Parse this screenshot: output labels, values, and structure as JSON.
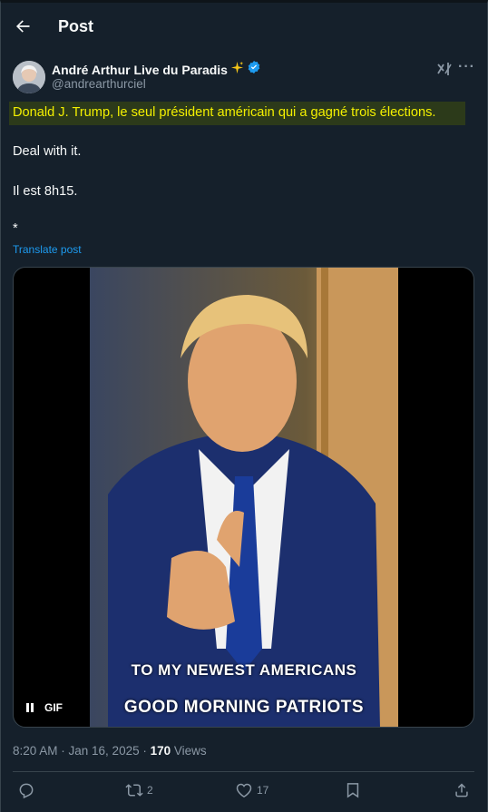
{
  "header": {
    "title": "Post"
  },
  "author": {
    "display_name": "André Arthur Live du Paradis",
    "handle": "@andrearthurciel",
    "verified": true
  },
  "post": {
    "highlighted_line": "Donald J. Trump, le seul président américain qui a gagné trois élections.",
    "line2": "Deal with it.",
    "line3": "Il est 8h15.",
    "line4": "*",
    "translate_label": "Translate post"
  },
  "media": {
    "caption_top": "TO MY NEWEST AMERICANS",
    "caption_bottom": "GOOD MORNING PATRIOTS",
    "gif_label": "GIF"
  },
  "meta": {
    "timestamp": "8:20 AM · Jan 16, 2025 · ",
    "views_count": "170",
    "views_label": " Views"
  },
  "actions": {
    "reposts": "2",
    "likes": "17"
  },
  "colors": {
    "background": "#15202b",
    "highlight_text": "#f3f000",
    "link": "#1d9bf0",
    "verified": "#1d9bf0",
    "muted": "#8b98a5"
  }
}
